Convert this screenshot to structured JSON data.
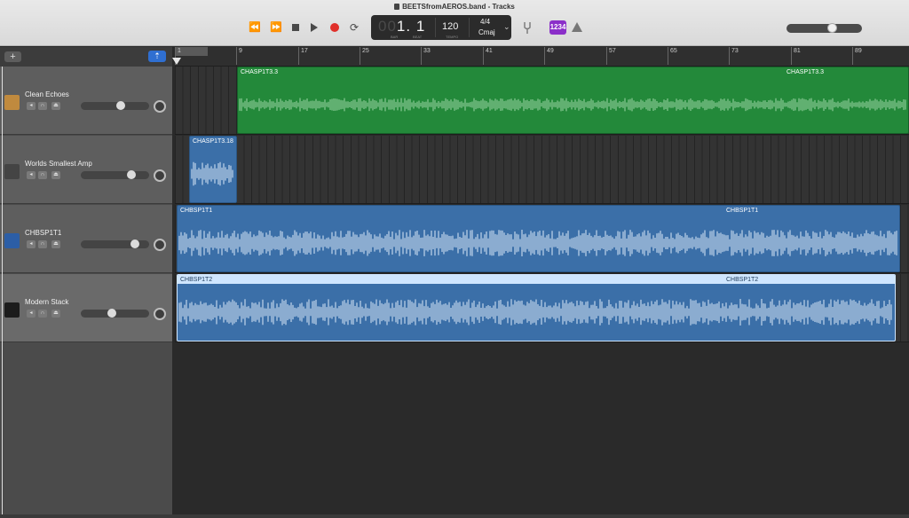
{
  "window": {
    "title": "BEETSfromAEROS.band - Tracks"
  },
  "transport": {
    "rewind_icon": "⏪",
    "ffwd_icon": "⏩",
    "cycle_icon": "⟳",
    "lcd": {
      "position_dim": "00",
      "position": "1. 1",
      "bar_label": "BAR",
      "beat_label": "BEAT",
      "tempo": "120",
      "tempo_label": "TEMPO",
      "time_signature": "4/4",
      "key": "Cmaj",
      "chevron": "⌄"
    },
    "tuner_icon": "tuning-fork-icon",
    "count_in": "1234",
    "master_volume": 0.62
  },
  "headers": {
    "add_label": "+",
    "smart_label": "⇡"
  },
  "tracks": [
    {
      "name": "Clean Echoes",
      "color": "#c08a3e",
      "volume": 0.6
    },
    {
      "name": "Worlds Smallest Amp",
      "color": "#444444",
      "volume": 0.78
    },
    {
      "name": "CHBSP1T1",
      "color": "#2c5ea6",
      "volume": 0.83
    },
    {
      "name": "Modern Stack",
      "color": "#1c1c1c",
      "volume": 0.45
    }
  ],
  "track_buttons": {
    "mute": "◂",
    "solo": "∩",
    "record": "⏏"
  },
  "ruler": {
    "bars": [
      "1",
      "9",
      "17",
      "25",
      "33",
      "41",
      "49",
      "57",
      "65",
      "73",
      "81",
      "89"
    ]
  },
  "regions": {
    "r1": {
      "name": "CHASP1T3.3",
      "name_repeat": "CHASP1T3.3"
    },
    "r2": {
      "name": "CHASP1T3.18"
    },
    "r3": {
      "name": "CHBSP1T1",
      "name_repeat": "CHBSP1T1"
    },
    "r4": {
      "name": "CHBSP1T2",
      "name_repeat": "CHBSP1T2"
    }
  }
}
